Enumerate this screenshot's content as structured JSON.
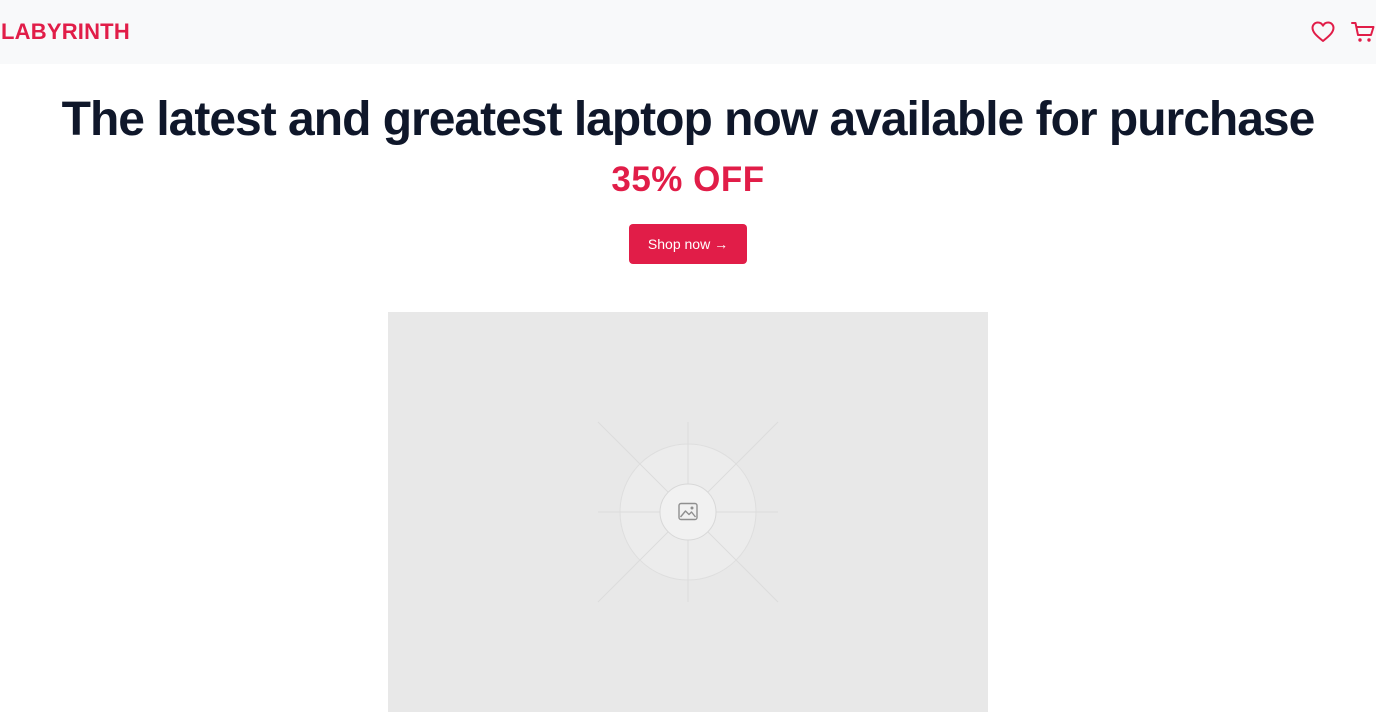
{
  "navbar": {
    "logo_text": "LABYRINTH",
    "icons": [
      "heart-icon",
      "cart-icon"
    ]
  },
  "hero": {
    "title": "The latest and greatest laptop now available for purchase",
    "discount": "35% OFF",
    "cta_label": "Shop now →"
  },
  "image": {
    "icon": "image-icon"
  },
  "colors": {
    "accent": "#e11d48",
    "title": "#0f172a",
    "navbar_bg": "#f8f9fa",
    "placeholder_bg": "#e8e8e8"
  }
}
